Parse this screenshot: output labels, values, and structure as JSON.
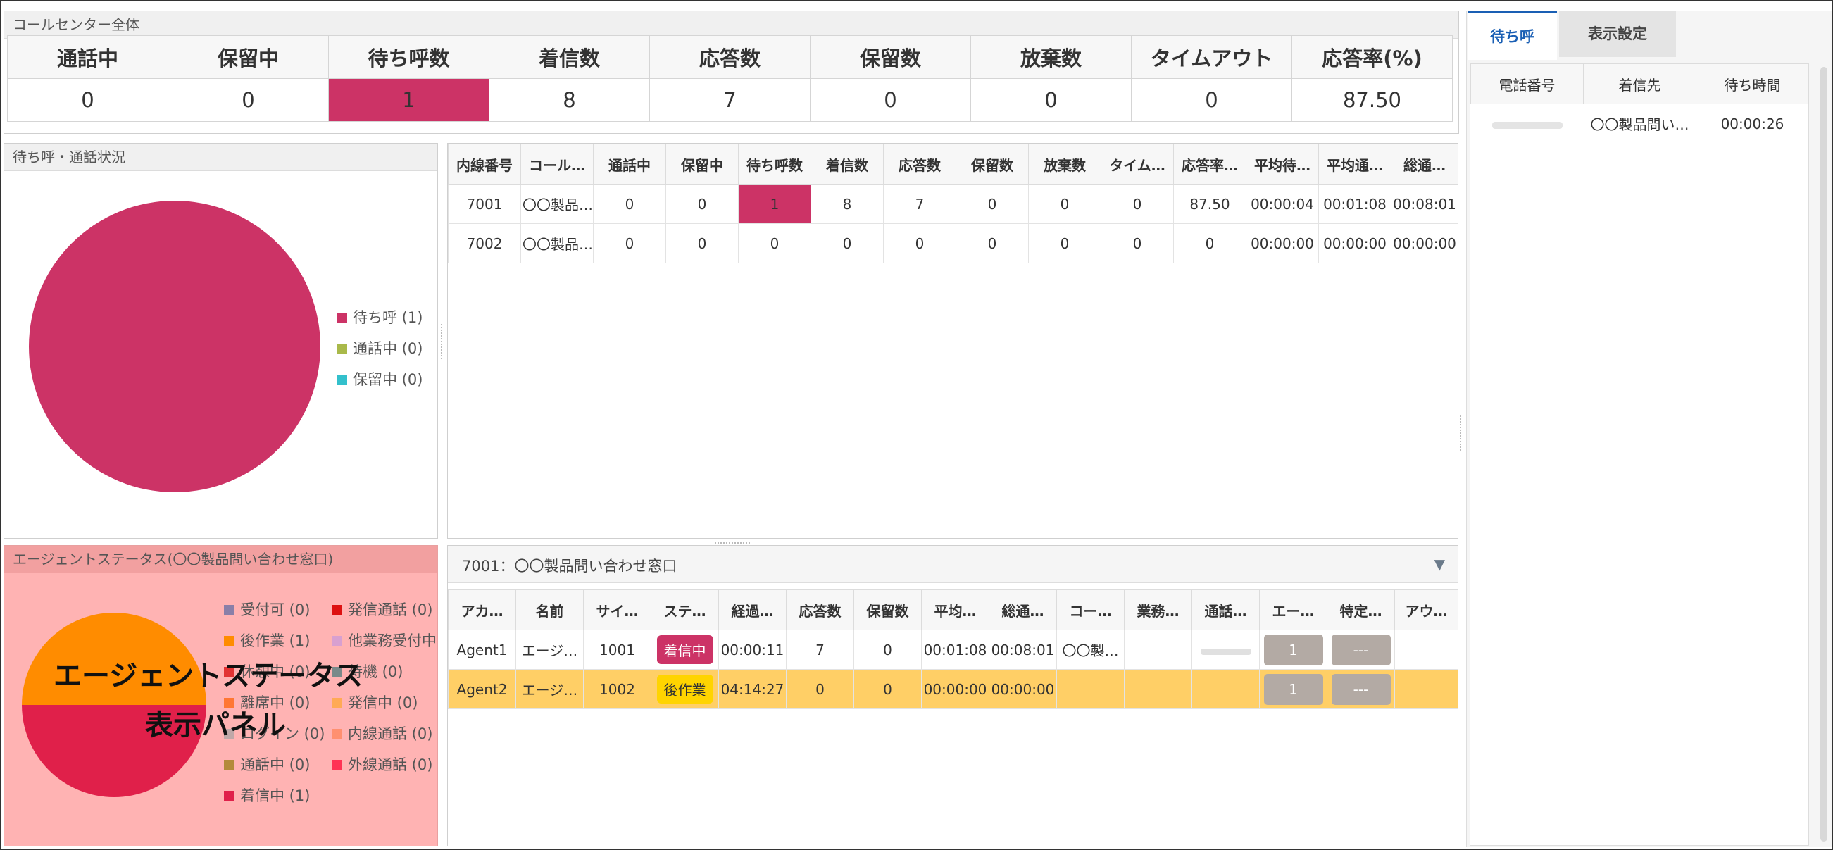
{
  "summary": {
    "title": "コールセンター全体",
    "headers": [
      "通話中",
      "保留中",
      "待ち呼数",
      "着信数",
      "応答数",
      "保留数",
      "放棄数",
      "タイムアウト",
      "応答率(%)"
    ],
    "values": [
      "0",
      "0",
      "1",
      "8",
      "7",
      "0",
      "0",
      "0",
      "87.50"
    ]
  },
  "queue_chart": {
    "title": "待ち呼・通話状況",
    "legend": [
      "待ち呼 (1)",
      "通話中 (0)",
      "保留中 (0)"
    ],
    "colors": [
      "#cc3366",
      "#a9b94a",
      "#33c0cc"
    ]
  },
  "ext_table": {
    "headers": [
      "内線番号",
      "コール…",
      "通話中",
      "保留中",
      "待ち呼数",
      "着信数",
      "応答数",
      "保留数",
      "放棄数",
      "タイム…",
      "応答率…",
      "平均待…",
      "平均通…",
      "総通…"
    ],
    "rows": [
      [
        "7001",
        "〇〇製品…",
        "0",
        "0",
        "1",
        "8",
        "7",
        "0",
        "0",
        "0",
        "87.50",
        "00:00:04",
        "00:01:08",
        "00:08:01"
      ],
      [
        "7002",
        "〇〇製品…",
        "0",
        "0",
        "0",
        "0",
        "0",
        "0",
        "0",
        "0",
        "0",
        "00:00:00",
        "00:00:00",
        "00:00:00"
      ]
    ]
  },
  "agent_status": {
    "title": "エージェントステータス(〇〇製品問い合わせ窓口)",
    "legend_left": [
      "受付可 (0)",
      "後作業 (1)",
      "休憩中 (0)",
      "離席中 (0)",
      "ログイン (0)",
      "通話中 (0)",
      "着信中 (1)"
    ],
    "legend_right": [
      "発信通話 (0)",
      "他業務受付中",
      "待機 (0)",
      "発信中 (0)",
      "内線通話 (0)",
      "外線通話 (0)"
    ],
    "colors_left": [
      "#8a7fa8",
      "#ff8c00",
      "#e23333",
      "#ff7733",
      "#c0a8a8",
      "#b38a3a",
      "#e0204a"
    ],
    "colors_right": [
      "#dd1111",
      "#d8a0d0",
      "#7a8a8a",
      "#ffaa55",
      "#ff9070",
      "#ff3355"
    ],
    "overlay_line1": "エージェントステータス",
    "overlay_line2": "表示パネル"
  },
  "agent_table": {
    "queue_label": "7001：〇〇製品問い合わせ窓口",
    "headers": [
      "アカ…",
      "名前",
      "サイ…",
      "ステ…",
      "経過…",
      "応答数",
      "保留数",
      "平均…",
      "総通…",
      "コー…",
      "業務…",
      "通話…",
      "エー…",
      "特定…",
      "アウ…"
    ],
    "rows": [
      {
        "account": "Agent1",
        "name": "エージ…",
        "site": "1001",
        "status": "着信中",
        "elapsed": "00:00:11",
        "answered": "7",
        "hold": "0",
        "avg": "00:01:08",
        "total": "00:08:01",
        "code": "〇〇製…",
        "task": "",
        "call": "",
        "agent_btn": "1",
        "special_btn": "---",
        "out": ""
      },
      {
        "account": "Agent2",
        "name": "エージ…",
        "site": "1002",
        "status": "後作業",
        "elapsed": "04:14:27",
        "answered": "0",
        "hold": "0",
        "avg": "00:00:00",
        "total": "00:00:00",
        "code": "",
        "task": "",
        "call": "",
        "agent_btn": "1",
        "special_btn": "---",
        "out": ""
      }
    ]
  },
  "right_panel": {
    "tabs": [
      "待ち呼",
      "表示設定"
    ],
    "headers": [
      "電話番号",
      "着信先",
      "待ち時間"
    ],
    "row": {
      "phone": "",
      "dest": "〇〇製品問い…",
      "wait": "00:00:26"
    }
  },
  "colors": {
    "alert": "#cc3366",
    "highlight_row": "#ffcf66",
    "accent_tab": "#1a5fb4"
  }
}
